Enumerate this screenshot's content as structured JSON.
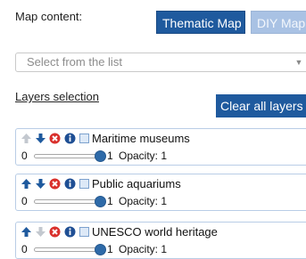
{
  "header": {
    "map_content_label": "Map content:",
    "tabs": [
      {
        "label": "Thematic Map",
        "active": true
      },
      {
        "label": "DIY Map",
        "active": false
      }
    ]
  },
  "select": {
    "placeholder": "Select from the list"
  },
  "layers": {
    "heading": "Layers selection",
    "clear_button": "Clear all layers",
    "items": [
      {
        "name": "Maritime museums",
        "min": "0",
        "max": "1",
        "opacity": "Opacity: 1",
        "opacity_value": 1,
        "up_enabled": false,
        "down_enabled": true,
        "visible": true
      },
      {
        "name": "Public aquariums",
        "min": "0",
        "max": "1",
        "opacity": "Opacity: 1",
        "opacity_value": 1,
        "up_enabled": true,
        "down_enabled": true,
        "visible": true
      },
      {
        "name": "UNESCO world heritage",
        "min": "0",
        "max": "1",
        "opacity": "Opacity: 1",
        "opacity_value": 1,
        "up_enabled": true,
        "down_enabled": false,
        "visible": true
      }
    ]
  },
  "colors": {
    "accent": "#1f5a9e",
    "tab_inactive": "#a9c2e4",
    "remove": "#d9302c",
    "info": "#1f4f94"
  },
  "icons": [
    "arrow-up-icon",
    "arrow-down-icon",
    "remove-icon",
    "info-icon",
    "chevron-down-icon"
  ]
}
